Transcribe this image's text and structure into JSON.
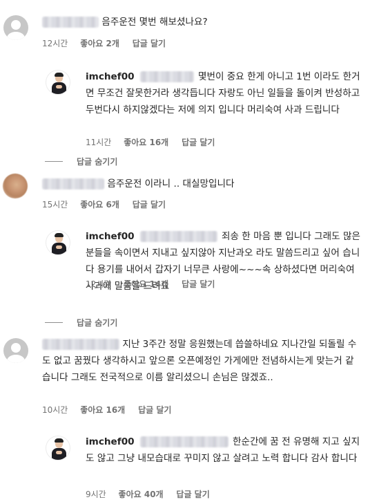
{
  "comments": [
    {
      "text": "음주운전 몇번 해보셨나요?",
      "time": "12시간",
      "likes": "좋아요 2개",
      "reply": "답글 달기",
      "reply_item": {
        "username": "imchef00",
        "text": "몇번이 중요 한게 아니고 1번 이라도 한거면 무조건 잘못한거라 생각듭니다 자랑도 아닌 일들을 돌이켜 반성하고 두번다시 하지않겠다는 저에 의지 입니다 머리숙여 사과 드립니다",
        "time": "11시간",
        "likes": "좋아요 16개",
        "reply": "답글 달기"
      },
      "hide_replies": "답글 숨기기"
    },
    {
      "text": "음주운전 이라니 .. 대실망입니다",
      "time": "15시간",
      "likes": "좋아요 6개",
      "reply": "답글 달기",
      "reply_item": {
        "username": "imchef00",
        "text": "죄송 한 마음 뿐 입니다 그래도 많은 분들을 속이면서 지내고 싶지않아 지난과오 라도 말씀드리고 싶어 습니다 용기를 내어서 갑자기 너무큰 사랑에~~~속 상하셨다면 머리숙여 사과에 말씀을 드려요",
        "time": "12시간",
        "likes": "좋아요 14개",
        "reply": "답글 달기"
      },
      "hide_replies": "답글 숨기기"
    },
    {
      "text": "지난 3주간 정말 응원했는데 씁쓸하네요 지나간일 되돌릴 수도 없고 꿈꿨다 생각하시고 앞으론 오픈예정인 가게에만 전념하시는게 맞는거 같습니다 그래도 전국적으로 이름 알리셨으니 손님은 많겠죠..",
      "time": "10시간",
      "likes": "좋아요 16개",
      "reply": "답글 달기",
      "reply_item": {
        "username": "imchef00",
        "text": "한순간에 꿈 전 유명해 지고 싶지도 않고 그냥 내모습대로 꾸미지 않고 살려고 노력 합니다 감사 합니다",
        "time": "9시간",
        "likes": "좋아요 40개",
        "reply": "답글 달기"
      }
    }
  ],
  "icons": {
    "default_avatar": "person-silhouette",
    "blurred_avatar": "blurred-photo",
    "chef_avatar": "chef-photo"
  },
  "colors": {
    "text": "#262626",
    "meta": "#737373",
    "avatar_gray": "#c7c7c7"
  }
}
